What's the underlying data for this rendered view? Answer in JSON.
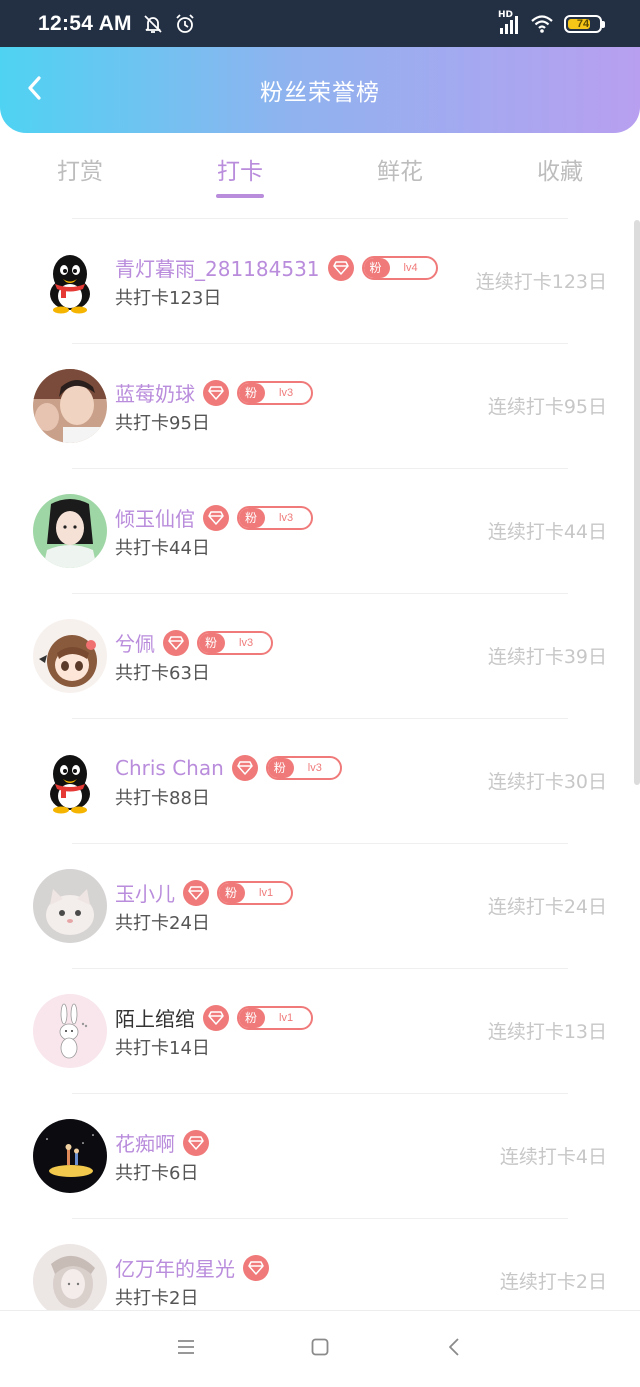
{
  "status_bar": {
    "time": "12:54 AM",
    "battery": "74",
    "battery_level": 0.74,
    "network": "HD",
    "icons": [
      "mute-bell-icon",
      "alarm-icon",
      "signal-icon",
      "wifi-icon",
      "battery-icon"
    ]
  },
  "header": {
    "title": "粉丝荣誉榜",
    "back_icon": "chevron-left-icon"
  },
  "tabs": [
    {
      "label": "打赏",
      "active": false
    },
    {
      "label": "打卡",
      "active": true
    },
    {
      "label": "鲜花",
      "active": false
    },
    {
      "label": "收藏",
      "active": false
    }
  ],
  "fan_badge_text": "粉",
  "list": [
    {
      "name": "青灯暮雨_281184531",
      "total": "共打卡123日",
      "streak": "连续打卡123日",
      "level": "lv4",
      "has_fan_badge": true,
      "avatar": "qq-penguin"
    },
    {
      "name": "蓝莓奶球",
      "total": "共打卡95日",
      "streak": "连续打卡95日",
      "level": "lv3",
      "has_fan_badge": true,
      "avatar": "photo-boy"
    },
    {
      "name": "倾玉仙倌",
      "total": "共打卡44日",
      "streak": "连续打卡44日",
      "level": "lv3",
      "has_fan_badge": true,
      "avatar": "photo-costume"
    },
    {
      "name": "兮佩",
      "total": "共打卡63日",
      "streak": "连续打卡39日",
      "level": "lv3",
      "has_fan_badge": true,
      "avatar": "anime-girl"
    },
    {
      "name": "Chris Chan",
      "total": "共打卡88日",
      "streak": "连续打卡30日",
      "level": "lv3",
      "has_fan_badge": true,
      "avatar": "qq-penguin"
    },
    {
      "name": "玉小儿",
      "total": "共打卡24日",
      "streak": "连续打卡24日",
      "level": "lv1",
      "has_fan_badge": true,
      "avatar": "kitten"
    },
    {
      "name": "陌上绾绾",
      "total": "共打卡14日",
      "streak": "连续打卡13日",
      "level": "lv1",
      "has_fan_badge": true,
      "avatar": "bunny",
      "dark_name": true
    },
    {
      "name": "花痴啊",
      "total": "共打卡6日",
      "streak": "连续打卡4日",
      "level": "",
      "has_fan_badge": false,
      "avatar": "night-scene"
    },
    {
      "name": "亿万年的星光",
      "total": "共打卡2日",
      "streak": "连续打卡2日",
      "level": "",
      "has_fan_badge": false,
      "avatar": "sketch-girl"
    }
  ],
  "navbar": {
    "icons": [
      "menu-icon",
      "home-square-icon",
      "back-triangle-icon"
    ]
  },
  "colors": {
    "accent": "#b98cdc",
    "badge": "#f07a7a",
    "header_start": "#4fd3f3",
    "header_end": "#b89ff0",
    "status_bar": "#233044"
  }
}
